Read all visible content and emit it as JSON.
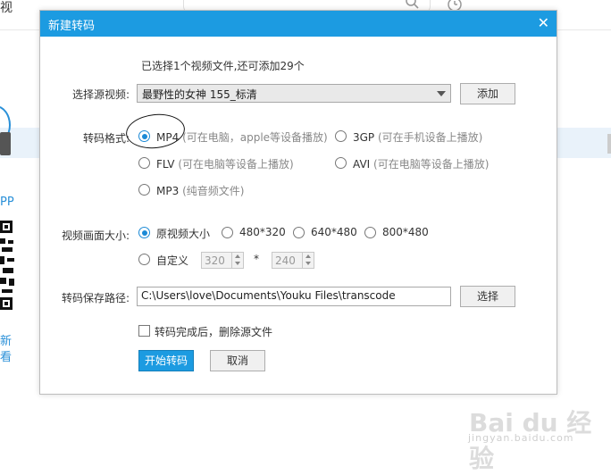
{
  "background": {
    "title_fragment": "视",
    "pp_label": "PP",
    "side_text_1": "新",
    "side_text_2": "看"
  },
  "dialog": {
    "title": "新建转码",
    "close_glyph": "✕",
    "info": "已选择1个视频文件,还可添加29个",
    "source": {
      "label": "选择源视频:",
      "value": "最野性的女神 155_标清",
      "add_button": "添加"
    },
    "format": {
      "label": "转码格式:",
      "options": [
        {
          "name": "MP4",
          "hint": "(可在电脑，apple等设备播放)",
          "selected": true
        },
        {
          "name": "3GP",
          "hint": "(可在手机设备上播放)",
          "selected": false
        },
        {
          "name": "FLV",
          "hint": "(可在电脑等设备上播放)",
          "selected": false
        },
        {
          "name": "AVI",
          "hint": "(可在电脑等设备上播放)",
          "selected": false
        },
        {
          "name": "MP3",
          "hint": "(纯音频文件)",
          "selected": false
        }
      ]
    },
    "size": {
      "label": "视频画面大小:",
      "options": [
        {
          "name": "原视频大小",
          "selected": true
        },
        {
          "name": "480*320",
          "selected": false
        },
        {
          "name": "640*480",
          "selected": false
        },
        {
          "name": "800*480",
          "selected": false
        }
      ],
      "custom_label": "自定义",
      "custom_width": "320",
      "custom_separator": "*",
      "custom_height": "240"
    },
    "path": {
      "label": "转码保存路径:",
      "value": "C:\\Users\\love\\Documents\\Youku Files\\transcode",
      "choose_button": "选择"
    },
    "delete_source": {
      "label": "转码完成后，删除源文件",
      "checked": false
    },
    "start_button": "开始转码",
    "cancel_button": "取消"
  },
  "watermark": {
    "brand": "Bai du 经验",
    "url": "jingyan.baidu.com"
  },
  "colors": {
    "titlebar": "#1c9be1",
    "accent": "#1c8ad6"
  }
}
